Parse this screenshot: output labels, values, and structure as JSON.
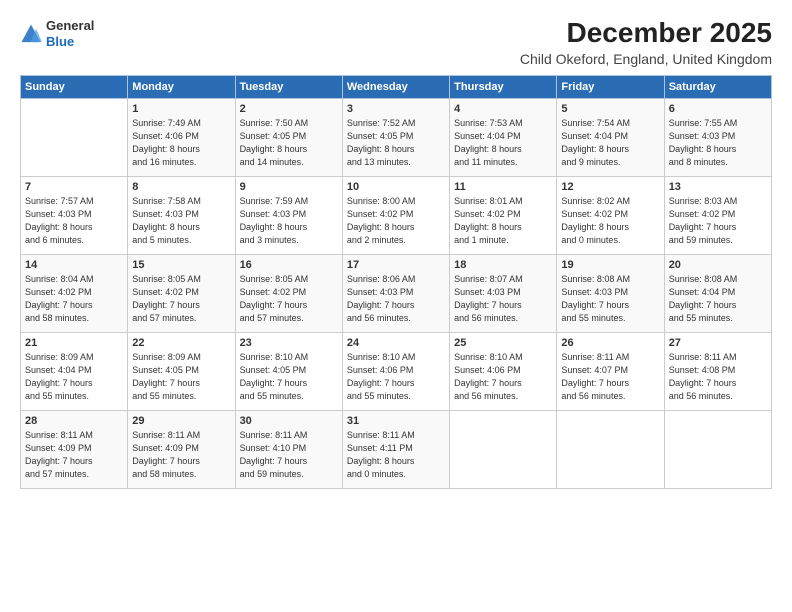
{
  "logo": {
    "general": "General",
    "blue": "Blue"
  },
  "title": "December 2025",
  "subtitle": "Child Okeford, England, United Kingdom",
  "headers": [
    "Sunday",
    "Monday",
    "Tuesday",
    "Wednesday",
    "Thursday",
    "Friday",
    "Saturday"
  ],
  "weeks": [
    [
      {
        "day": "",
        "info": ""
      },
      {
        "day": "1",
        "info": "Sunrise: 7:49 AM\nSunset: 4:06 PM\nDaylight: 8 hours\nand 16 minutes."
      },
      {
        "day": "2",
        "info": "Sunrise: 7:50 AM\nSunset: 4:05 PM\nDaylight: 8 hours\nand 14 minutes."
      },
      {
        "day": "3",
        "info": "Sunrise: 7:52 AM\nSunset: 4:05 PM\nDaylight: 8 hours\nand 13 minutes."
      },
      {
        "day": "4",
        "info": "Sunrise: 7:53 AM\nSunset: 4:04 PM\nDaylight: 8 hours\nand 11 minutes."
      },
      {
        "day": "5",
        "info": "Sunrise: 7:54 AM\nSunset: 4:04 PM\nDaylight: 8 hours\nand 9 minutes."
      },
      {
        "day": "6",
        "info": "Sunrise: 7:55 AM\nSunset: 4:03 PM\nDaylight: 8 hours\nand 8 minutes."
      }
    ],
    [
      {
        "day": "7",
        "info": "Sunrise: 7:57 AM\nSunset: 4:03 PM\nDaylight: 8 hours\nand 6 minutes."
      },
      {
        "day": "8",
        "info": "Sunrise: 7:58 AM\nSunset: 4:03 PM\nDaylight: 8 hours\nand 5 minutes."
      },
      {
        "day": "9",
        "info": "Sunrise: 7:59 AM\nSunset: 4:03 PM\nDaylight: 8 hours\nand 3 minutes."
      },
      {
        "day": "10",
        "info": "Sunrise: 8:00 AM\nSunset: 4:02 PM\nDaylight: 8 hours\nand 2 minutes."
      },
      {
        "day": "11",
        "info": "Sunrise: 8:01 AM\nSunset: 4:02 PM\nDaylight: 8 hours\nand 1 minute."
      },
      {
        "day": "12",
        "info": "Sunrise: 8:02 AM\nSunset: 4:02 PM\nDaylight: 8 hours\nand 0 minutes."
      },
      {
        "day": "13",
        "info": "Sunrise: 8:03 AM\nSunset: 4:02 PM\nDaylight: 7 hours\nand 59 minutes."
      }
    ],
    [
      {
        "day": "14",
        "info": "Sunrise: 8:04 AM\nSunset: 4:02 PM\nDaylight: 7 hours\nand 58 minutes."
      },
      {
        "day": "15",
        "info": "Sunrise: 8:05 AM\nSunset: 4:02 PM\nDaylight: 7 hours\nand 57 minutes."
      },
      {
        "day": "16",
        "info": "Sunrise: 8:05 AM\nSunset: 4:02 PM\nDaylight: 7 hours\nand 57 minutes."
      },
      {
        "day": "17",
        "info": "Sunrise: 8:06 AM\nSunset: 4:03 PM\nDaylight: 7 hours\nand 56 minutes."
      },
      {
        "day": "18",
        "info": "Sunrise: 8:07 AM\nSunset: 4:03 PM\nDaylight: 7 hours\nand 56 minutes."
      },
      {
        "day": "19",
        "info": "Sunrise: 8:08 AM\nSunset: 4:03 PM\nDaylight: 7 hours\nand 55 minutes."
      },
      {
        "day": "20",
        "info": "Sunrise: 8:08 AM\nSunset: 4:04 PM\nDaylight: 7 hours\nand 55 minutes."
      }
    ],
    [
      {
        "day": "21",
        "info": "Sunrise: 8:09 AM\nSunset: 4:04 PM\nDaylight: 7 hours\nand 55 minutes."
      },
      {
        "day": "22",
        "info": "Sunrise: 8:09 AM\nSunset: 4:05 PM\nDaylight: 7 hours\nand 55 minutes."
      },
      {
        "day": "23",
        "info": "Sunrise: 8:10 AM\nSunset: 4:05 PM\nDaylight: 7 hours\nand 55 minutes."
      },
      {
        "day": "24",
        "info": "Sunrise: 8:10 AM\nSunset: 4:06 PM\nDaylight: 7 hours\nand 55 minutes."
      },
      {
        "day": "25",
        "info": "Sunrise: 8:10 AM\nSunset: 4:06 PM\nDaylight: 7 hours\nand 56 minutes."
      },
      {
        "day": "26",
        "info": "Sunrise: 8:11 AM\nSunset: 4:07 PM\nDaylight: 7 hours\nand 56 minutes."
      },
      {
        "day": "27",
        "info": "Sunrise: 8:11 AM\nSunset: 4:08 PM\nDaylight: 7 hours\nand 56 minutes."
      }
    ],
    [
      {
        "day": "28",
        "info": "Sunrise: 8:11 AM\nSunset: 4:09 PM\nDaylight: 7 hours\nand 57 minutes."
      },
      {
        "day": "29",
        "info": "Sunrise: 8:11 AM\nSunset: 4:09 PM\nDaylight: 7 hours\nand 58 minutes."
      },
      {
        "day": "30",
        "info": "Sunrise: 8:11 AM\nSunset: 4:10 PM\nDaylight: 7 hours\nand 59 minutes."
      },
      {
        "day": "31",
        "info": "Sunrise: 8:11 AM\nSunset: 4:11 PM\nDaylight: 8 hours\nand 0 minutes."
      },
      {
        "day": "",
        "info": ""
      },
      {
        "day": "",
        "info": ""
      },
      {
        "day": "",
        "info": ""
      }
    ]
  ]
}
